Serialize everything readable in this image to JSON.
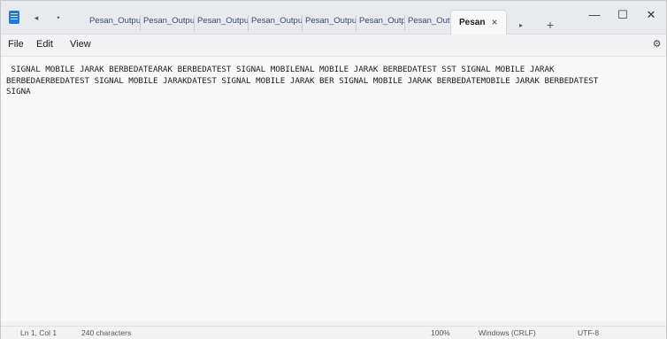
{
  "tabs": {
    "items": [
      "Pesan_Outpu",
      "Pesan_Outpu",
      "Pesan_Outpu",
      "Pesan_Outpu",
      "Pesan_Outpu",
      "Pesan_Outpu",
      "Pesan_Outpu"
    ],
    "active_label": "Pesan",
    "close_glyph": "×",
    "add_glyph": "+",
    "scroll_glyph": "▸"
  },
  "window_controls": {
    "minimize": "—",
    "maximize": "☐",
    "close": "✕"
  },
  "nav": {
    "back": "◂",
    "dot": "•"
  },
  "menu": {
    "file": "File",
    "edit": "Edit",
    "view": "View"
  },
  "icons": {
    "settings": "⚙",
    "app": "notepad-icon"
  },
  "editor": {
    "content": " SIGNAL MOBILE JARAK BERBEDATEARAK BERBEDATEST SIGNAL MOBILENAL MOBILE JARAK BERBEDATEST SST SIGNAL MOBILE JARAK\nBERBEDAERBEDATEST SIGNAL MOBILE JARAKDATEST SIGNAL MOBILE JARAK BER SIGNAL MOBILE JARAK BERBEDATEMOBILE JARAK BERBEDATEST\nSIGNA"
  },
  "status": {
    "position": "Ln 1, Col 1",
    "characters": "240 characters",
    "zoom": "100%",
    "line_ending": "Windows (CRLF)",
    "encoding": "UTF-8"
  }
}
